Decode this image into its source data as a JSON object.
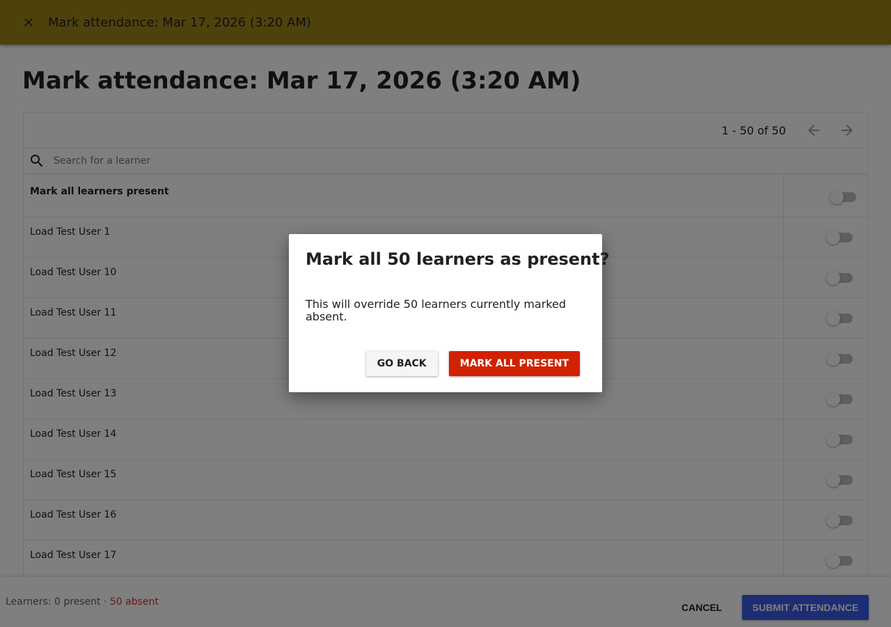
{
  "app_bar": {
    "title": "Mark attendance: Mar 17, 2026 (3:20 AM)",
    "close_icon": "close-icon",
    "background": "#9a8418"
  },
  "page": {
    "heading": "Mark attendance: Mar 17, 2026 (3:20 AM)"
  },
  "pagination": {
    "range_text": "1 - 50 of 50",
    "prev_icon": "arrow-back-icon",
    "next_icon": "arrow-forward-icon"
  },
  "search": {
    "placeholder": "Search for a learner",
    "value": "",
    "icon": "search-icon"
  },
  "mark_all_row": {
    "label": "Mark all learners present",
    "toggle_on": false
  },
  "learners": [
    {
      "name": "Load Test User 1",
      "present": false
    },
    {
      "name": "Load Test User 10",
      "present": false
    },
    {
      "name": "Load Test User 11",
      "present": false
    },
    {
      "name": "Load Test User 12",
      "present": false
    },
    {
      "name": "Load Test User 13",
      "present": false
    },
    {
      "name": "Load Test User 14",
      "present": false
    },
    {
      "name": "Load Test User 15",
      "present": false
    },
    {
      "name": "Load Test User 16",
      "present": false
    },
    {
      "name": "Load Test User 17",
      "present": false
    }
  ],
  "footer": {
    "summary_prefix": "Learners: 0 present · ",
    "absent_text": "50 absent",
    "cancel_label": "CANCEL",
    "submit_label": "SUBMIT ATTENDANCE",
    "absent_color": "#d32f2f",
    "submit_color": "#3a5ae8"
  },
  "dialog": {
    "title": "Mark all 50 learners as present?",
    "body": "This will override 50 learners currently marked absent.",
    "back_label": "GO BACK",
    "confirm_label": "MARK ALL PRESENT",
    "confirm_color": "#d12200"
  }
}
